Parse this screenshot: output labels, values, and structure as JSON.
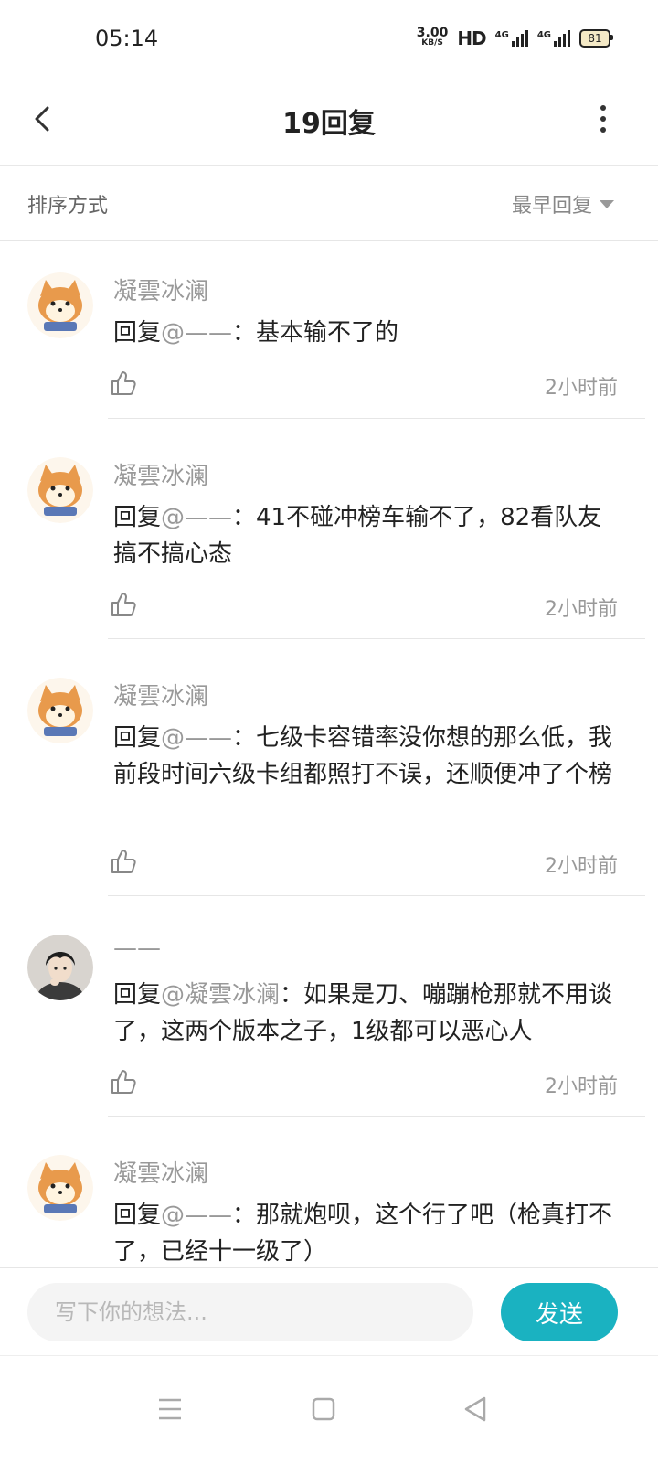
{
  "status": {
    "time": "05:14",
    "net_speed_value": "3.00",
    "net_speed_unit": "KB/S",
    "hd": "HD",
    "sig1_label": "4G",
    "sig2_label": "4G",
    "battery": "81"
  },
  "header": {
    "title": "19回复"
  },
  "sort": {
    "label": "排序方式",
    "option": "最早回复"
  },
  "comments": [
    {
      "user": "凝雲冰澜",
      "prefix": "回复",
      "mention": "@——",
      "body": "：基本输不了的",
      "time": "2小时前",
      "avatar": "shiba-avatar"
    },
    {
      "user": "凝雲冰澜",
      "prefix": "回复",
      "mention": "@——",
      "body": "：41不碰冲榜车输不了，82看队友搞不搞心态",
      "time": "2小时前",
      "avatar": "shiba-avatar"
    },
    {
      "user": "凝雲冰澜",
      "prefix": "回复",
      "mention": "@——",
      "body": "：七级卡容错率没你想的那么低，我前段时间六级卡组都照打不误，还顺便冲了个榜",
      "time": "2小时前",
      "avatar": "shiba-avatar"
    },
    {
      "user": "——",
      "prefix": "回复",
      "mention": "@凝雲冰澜",
      "body": "：如果是刀、嘣蹦枪那就不用谈了，这两个版本之子，1级都可以恶心人",
      "time": "2小时前",
      "avatar": "person-avatar"
    },
    {
      "user": "凝雲冰澜",
      "prefix": "回复",
      "mention": "@——",
      "body": "：那就炮呗，这个行了吧（枪真打不了，已经十一级了）",
      "time": "",
      "avatar": "shiba-avatar"
    }
  ],
  "composer": {
    "placeholder": "写下你的想法...",
    "send_label": "发送"
  },
  "colors": {
    "accent": "#1ab2c1",
    "muted_text": "#999999",
    "divider": "#e6e6e6"
  }
}
